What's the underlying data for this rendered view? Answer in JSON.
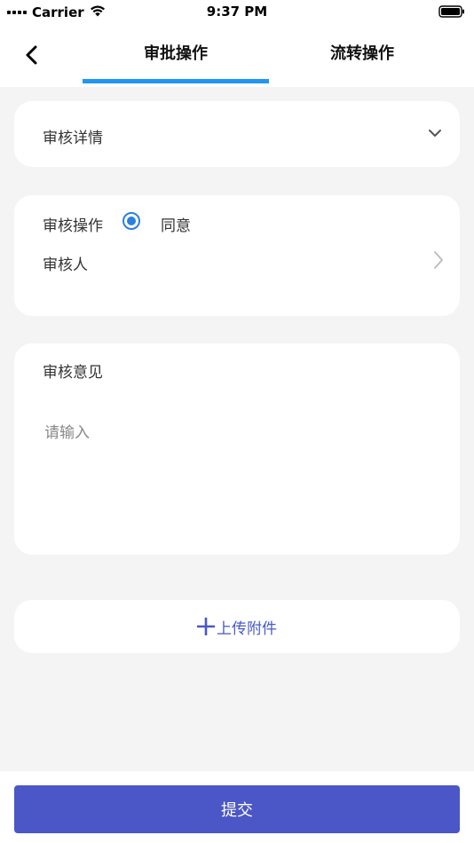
{
  "status_bar": {
    "carrier": "Carrier",
    "time": "9:37 PM",
    "icons": [
      "signal-dots-icon",
      "wifi-icon",
      "battery-icon"
    ]
  },
  "header": {
    "tabs": [
      {
        "label": "审批操作",
        "active": true
      },
      {
        "label": "流转操作",
        "active": false
      }
    ],
    "accent_color": "#2196f3"
  },
  "detail_section": {
    "label": "审核详情"
  },
  "operation_section": {
    "operation_label": "审核操作",
    "option_label": "同意",
    "option_selected": true,
    "reviewer_label": "审核人"
  },
  "opinion_section": {
    "label": "审核意见",
    "placeholder": "请输入",
    "value": ""
  },
  "upload": {
    "label": "上传附件",
    "color": "#4758c7"
  },
  "footer": {
    "submit_label": "提交",
    "button_color": "#4b57c6"
  }
}
